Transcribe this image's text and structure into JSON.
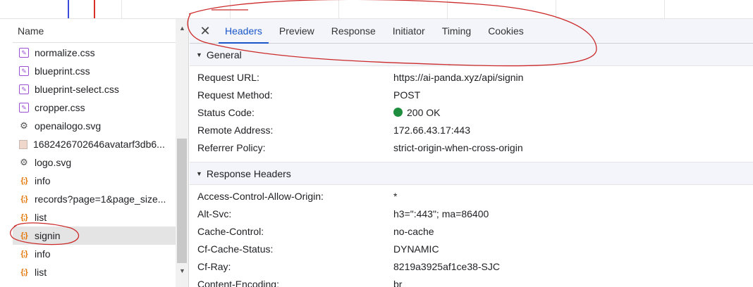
{
  "timeline": {},
  "request_list": {
    "header": "Name",
    "rows": [
      {
        "name": "normalize.css",
        "icon": "css-file-icon",
        "type": "css"
      },
      {
        "name": "blueprint.css",
        "icon": "css-file-icon",
        "type": "css"
      },
      {
        "name": "blueprint-select.css",
        "icon": "css-file-icon",
        "type": "css"
      },
      {
        "name": "cropper.css",
        "icon": "css-file-icon",
        "type": "css"
      },
      {
        "name": "openailogo.svg",
        "icon": "svg-file-icon",
        "type": "svg"
      },
      {
        "name": "1682426702646avatarf3db6...",
        "icon": "image-file-icon",
        "type": "img"
      },
      {
        "name": "logo.svg",
        "icon": "svg-file-icon",
        "type": "svg"
      },
      {
        "name": "info",
        "icon": "xhr-json-icon",
        "type": "xhr"
      },
      {
        "name": "records?page=1&page_size...",
        "icon": "xhr-json-icon",
        "type": "xhr"
      },
      {
        "name": "list",
        "icon": "xhr-json-icon",
        "type": "xhr"
      },
      {
        "name": "signin",
        "icon": "xhr-json-icon",
        "type": "xhr",
        "selected": true
      },
      {
        "name": "info",
        "icon": "xhr-json-icon",
        "type": "xhr"
      },
      {
        "name": "list",
        "icon": "xhr-json-icon",
        "type": "xhr"
      }
    ]
  },
  "tabs": {
    "close_icon": "close-icon",
    "items": [
      "Headers",
      "Preview",
      "Response",
      "Initiator",
      "Timing",
      "Cookies"
    ],
    "active": "Headers"
  },
  "general": {
    "title": "General",
    "rows": [
      {
        "key": "Request URL:",
        "value": "https://ai-panda.xyz/api/signin"
      },
      {
        "key": "Request Method:",
        "value": "POST"
      },
      {
        "key": "Status Code:",
        "value": "200 OK",
        "status_color": "#1e8e3e"
      },
      {
        "key": "Remote Address:",
        "value": "172.66.43.17:443"
      },
      {
        "key": "Referrer Policy:",
        "value": "strict-origin-when-cross-origin"
      }
    ]
  },
  "response_headers": {
    "title": "Response Headers",
    "rows": [
      {
        "key": "Access-Control-Allow-Origin:",
        "value": "*"
      },
      {
        "key": "Alt-Svc:",
        "value": "h3=\":443\"; ma=86400"
      },
      {
        "key": "Cache-Control:",
        "value": "no-cache"
      },
      {
        "key": "Cf-Cache-Status:",
        "value": "DYNAMIC"
      },
      {
        "key": "Cf-Ray:",
        "value": "8219a3925af1ce38-SJC"
      },
      {
        "key": "Content-Encoding:",
        "value": "br"
      }
    ]
  },
  "colors": {
    "accent": "#1a56c9",
    "annotation": "#cc2a2a",
    "selected_row": "#e4e4e4"
  }
}
